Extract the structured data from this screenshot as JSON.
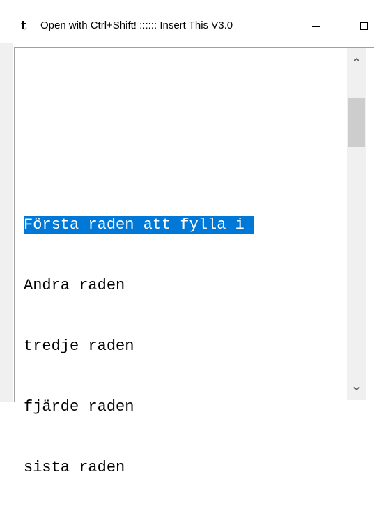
{
  "window": {
    "app_icon_glyph": "t",
    "title": "Open with Ctrl+Shift! :::::: Insert This V3.0",
    "minimize_icon": "minimize-icon",
    "maximize_icon": "maximize-icon"
  },
  "editor": {
    "lines": [
      {
        "text": "Första raden att fylla i ",
        "selected": true
      },
      {
        "text": "Andra raden",
        "selected": false
      },
      {
        "text": "tredje raden",
        "selected": false
      },
      {
        "text": "fjärde raden",
        "selected": false
      },
      {
        "text": "sista raden",
        "selected": false
      }
    ]
  },
  "colors": {
    "selection_bg": "#0078d7",
    "selection_text": "#ffffff",
    "window_bg": "#f0f0f0",
    "scroll_thumb": "#cdcdcd"
  }
}
